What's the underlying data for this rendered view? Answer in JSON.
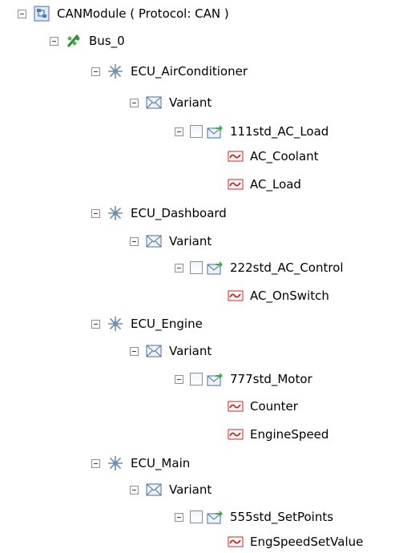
{
  "tree": {
    "root": {
      "label": "CANModule ( Protocol: CAN )"
    },
    "bus": {
      "label": "Bus_0"
    },
    "ecus": [
      {
        "label": "ECU_AirConditioner",
        "variant": "Variant",
        "frame": "111std_AC_Load",
        "signals": [
          "AC_Coolant",
          "AC_Load"
        ]
      },
      {
        "label": "ECU_Dashboard",
        "variant": "Variant",
        "frame": "222std_AC_Control",
        "signals": [
          "AC_OnSwitch"
        ]
      },
      {
        "label": "ECU_Engine",
        "variant": "Variant",
        "frame": "777std_Motor",
        "signals": [
          "Counter",
          "EngineSpeed"
        ]
      },
      {
        "label": "ECU_Main",
        "variant": "Variant",
        "frame": "555std_SetPoints",
        "signals": [
          "EngSpeedSetValue"
        ]
      }
    ]
  },
  "icons": {
    "module": "module-icon",
    "bus": "bus-icon",
    "ecu": "ecu-icon",
    "variant": "envelope-icon",
    "frame": "frame-envelope-icon",
    "signal": "signal-icon"
  }
}
